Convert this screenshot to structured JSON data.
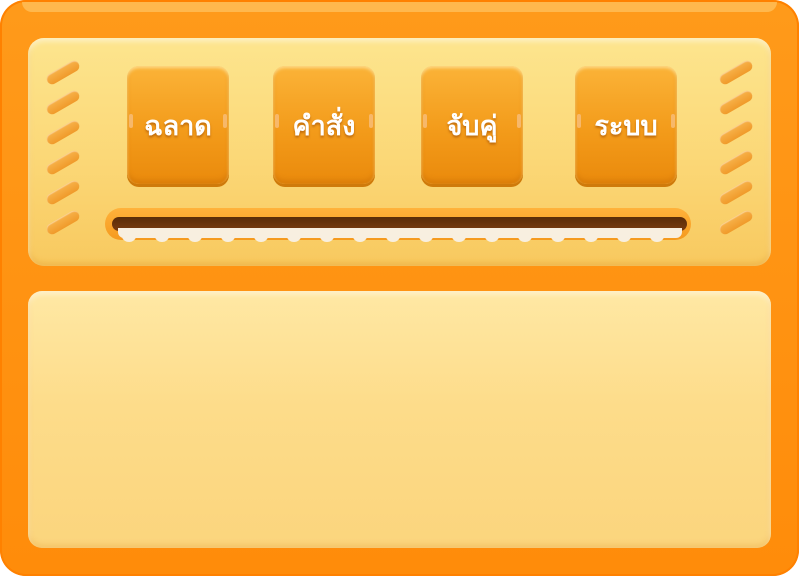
{
  "menu": {
    "buttons": [
      {
        "label": "ฉลาด"
      },
      {
        "label": "คำสั่ง"
      },
      {
        "label": "จับคู่"
      },
      {
        "label": "ระบบ"
      }
    ]
  },
  "colors": {
    "frame": "#ff9a1a",
    "panel": "#fde58e",
    "button": "#f39b1a",
    "rail_dark": "#5a2c08",
    "label": "#ffffff"
  }
}
